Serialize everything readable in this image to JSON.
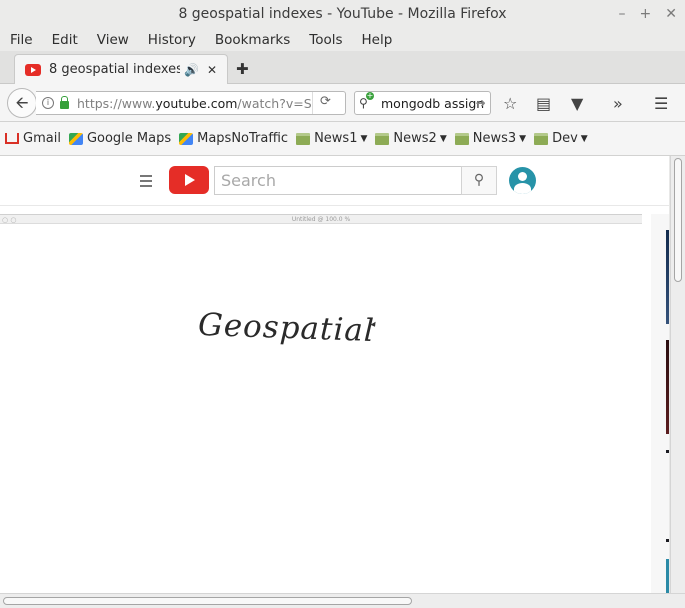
{
  "window": {
    "title": "8 geospatial indexes - YouTube - Mozilla Firefox"
  },
  "menu": {
    "items": [
      "File",
      "Edit",
      "View",
      "History",
      "Bookmarks",
      "Tools",
      "Help"
    ]
  },
  "tab": {
    "title": "8 geospatial indexes -...",
    "icon": "youtube-icon"
  },
  "urlbar": {
    "url_prefix": "https://www.",
    "url_domain": "youtube.com",
    "url_rest": "/watch?v=S"
  },
  "searchbar": {
    "value": "mongodb assign"
  },
  "bookmarks": {
    "items": [
      {
        "label": "Gmail",
        "icon": "gmail-icon"
      },
      {
        "label": "Google Maps",
        "icon": "maps-icon"
      },
      {
        "label": "MapsNoTraffic",
        "icon": "maps-icon"
      },
      {
        "label": "News1",
        "icon": "folder-icon"
      },
      {
        "label": "News2",
        "icon": "folder-icon"
      },
      {
        "label": "News3",
        "icon": "folder-icon"
      },
      {
        "label": "Dev",
        "icon": "folder-icon"
      }
    ]
  },
  "youtube": {
    "search_placeholder": "Search"
  },
  "video": {
    "window_title": "Untitled @ 100.0 %",
    "handwritten_text": "Geospatial"
  }
}
